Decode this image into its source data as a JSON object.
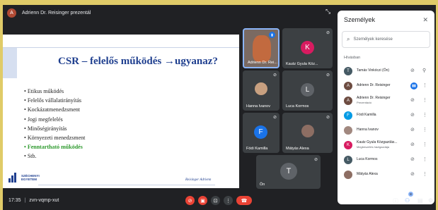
{
  "presentation": {
    "presenter_initial": "A",
    "banner": "Adrienn Dr. Reisinger prezentál"
  },
  "slide": {
    "title": "CSR – felelős működés →ugyanaz?",
    "bullets": [
      "Etikus működés",
      "Felelős vállalatirányítás",
      "Kockázatmenedzsment",
      "Jogi megfelelés",
      "Minőségirányítás",
      "Környezeti menedzsment",
      "Fenntartható működés",
      "Stb."
    ],
    "highlighted_index": 6,
    "logo_line1": "SZÉCHENYI",
    "logo_line2": "EGYETEM",
    "author": "Reisinger Adrienn"
  },
  "tiles": [
    {
      "name": "Adrienn Dr. Rei...",
      "type": "photo",
      "speaking": true
    },
    {
      "name": "Kautz Gyula Köz...",
      "type": "avatar",
      "initial": "K",
      "color": "#d81b60"
    },
    {
      "name": "Hanna Ivanov",
      "type": "photo"
    },
    {
      "name": "Luca Kormos",
      "type": "avatar",
      "initial": "L",
      "color": "#5f6368"
    },
    {
      "name": "Fódi Kamilla",
      "type": "avatar",
      "initial": "F",
      "color": "#1a73e8"
    },
    {
      "name": "Mátyás Alexa",
      "type": "photo"
    },
    {
      "name": "Ön",
      "type": "avatar",
      "initial": "T",
      "color": "#5f6368"
    }
  ],
  "people": {
    "title": "Személyek",
    "search_placeholder": "Személyek keresése",
    "section": "Hívásban",
    "list": [
      {
        "name": "Tamás Vinkóczi (Ön)",
        "initial": "T",
        "color": "#455a64"
      },
      {
        "name": "Adrienn Dr. Reisinger",
        "initial": "A",
        "color": "#6d4c41",
        "speaking": true
      },
      {
        "name": "Adrienn Dr. Reisinger",
        "sub": "Prezentáció",
        "initial": "A",
        "color": "#6d4c41"
      },
      {
        "name": "Fódi Kamilla",
        "initial": "F",
        "color": "#039be5"
      },
      {
        "name": "Hanna Ivanov",
        "initial": "",
        "color": "#a1887f"
      },
      {
        "name": "Kautz Gyula Közgazdás...",
        "sub": "Megbeszélés házigazdája",
        "initial": "K",
        "color": "#d81b60"
      },
      {
        "name": "Luca Kormos",
        "initial": "L",
        "color": "#455a64"
      },
      {
        "name": "Mátyás Alexa",
        "initial": "",
        "color": "#8d6e63"
      }
    ]
  },
  "bottom_bar": {
    "time": "17:35",
    "separator": "|",
    "meeting_code": "zvn-vqmp-xut",
    "participants_badge": "8"
  },
  "colors": {
    "background": "#202124",
    "tile": "#3c4043",
    "danger": "#ea4335",
    "accent": "#1a73e8"
  }
}
